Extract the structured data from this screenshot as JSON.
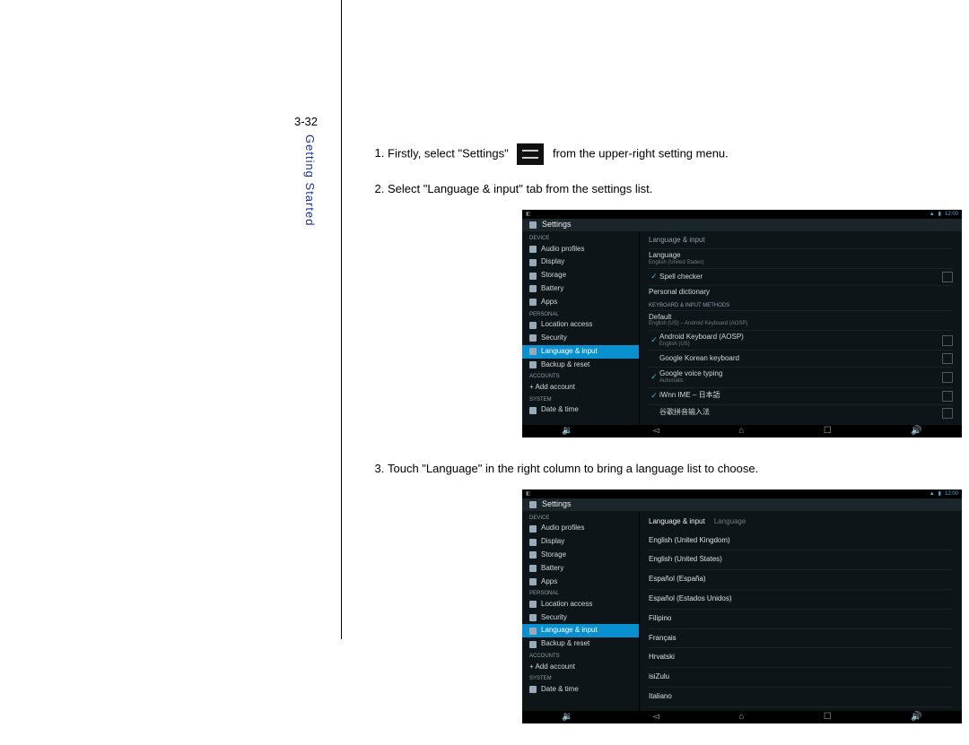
{
  "page_number": "3-32",
  "side_title": "Getting Started",
  "steps": [
    {
      "pre": "Firstly, select \"Settings\"",
      "post": "from the upper-right setting menu."
    },
    {
      "pre": "Select \"Language & input\" tab from the settings list."
    },
    {
      "pre": "Touch \"Language\" in the right column to bring a language list to choose."
    }
  ],
  "shot_a": {
    "title": "Settings",
    "sidebar_cats": {
      "device": "DEVICE",
      "personal": "PERSONAL",
      "accounts": "ACCOUNTS",
      "system": "SYSTEM"
    },
    "sidebar": {
      "audio": "Audio profiles",
      "display": "Display",
      "storage": "Storage",
      "battery": "Battery",
      "apps": "Apps",
      "location": "Location access",
      "security": "Security",
      "lang": "Language & input",
      "backup": "Backup & reset",
      "addacct": "+ Add account",
      "datetime": "Date & time"
    },
    "main": {
      "header": "Language & input",
      "language": {
        "label": "Language",
        "sub": "English (United States)"
      },
      "spell": "Spell checker",
      "dict": "Personal dictionary",
      "kbsec": "KEYBOARD & INPUT METHODS",
      "default": {
        "label": "Default",
        "sub": "English (US) – Android Keyboard (AOSP)"
      },
      "akb": {
        "label": "Android Keyboard (AOSP)",
        "sub": "English (US)"
      },
      "gkb": "Google Korean keyboard",
      "gvt": {
        "label": "Google voice typing",
        "sub": "Automatic"
      },
      "ja": "iWnn IME – 日本語",
      "more": "谷歌拼音输入法"
    }
  },
  "shot_b": {
    "title": "Settings",
    "header": "Language & input",
    "header_sub": "Language",
    "langs": [
      "English (United Kingdom)",
      "English (United States)",
      "Español (España)",
      "Español (Estados Unidos)",
      "Filipino",
      "Français",
      "Hrvatski",
      "isiZulu",
      "Italiano"
    ]
  }
}
